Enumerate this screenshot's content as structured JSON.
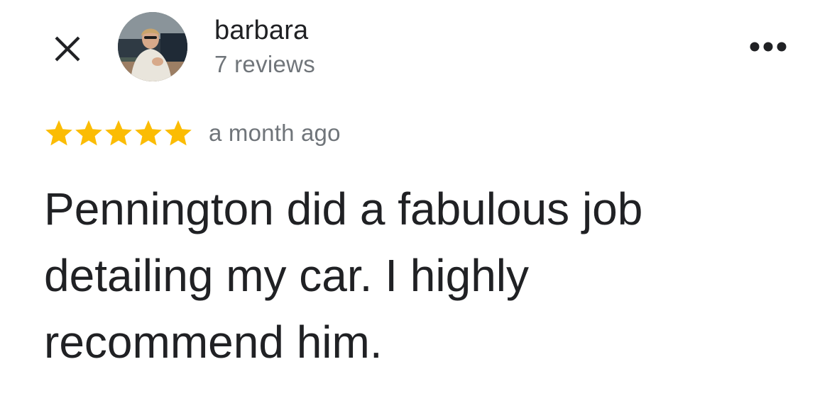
{
  "header": {
    "close_icon": "close-icon",
    "more_icon": "more-horizontal-icon"
  },
  "author": {
    "name": "barbara",
    "reviews": "7 reviews",
    "avatar_icon": "avatar-photo"
  },
  "review": {
    "rating": 5,
    "rating_max": 5,
    "star_color": "#fbbc04",
    "date": "a month ago",
    "text": "Pennington did a fabulous job\ndetailing my car.  I highly\nrecommend him."
  }
}
